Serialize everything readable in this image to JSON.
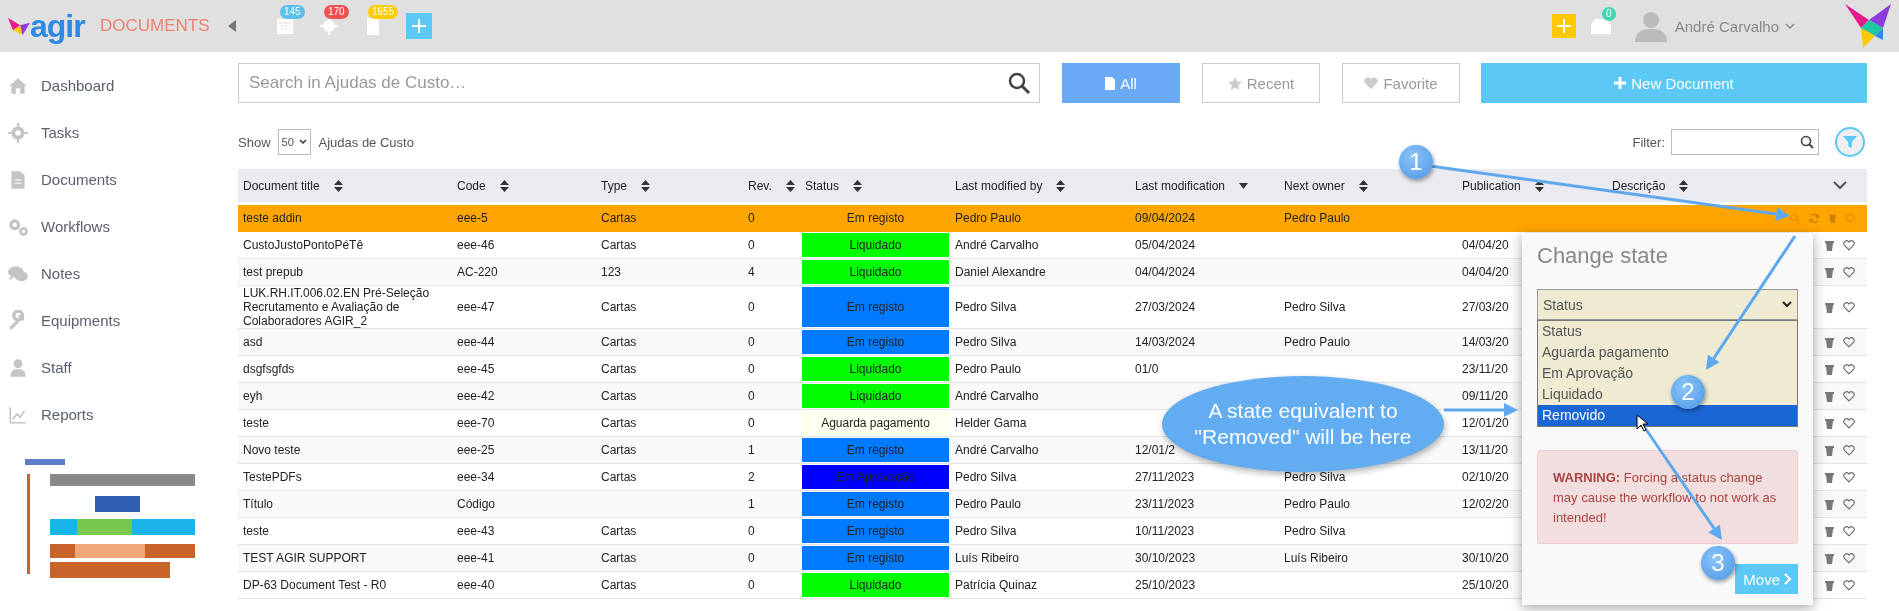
{
  "app": {
    "logo_text": "agir",
    "module": "DOCUMENTS"
  },
  "top_bar": {
    "badges": [
      {
        "count": "145",
        "color": "#5bc0eb"
      },
      {
        "count": "170",
        "color": "#f05050"
      },
      {
        "count": "1655",
        "color": "#ffcc00"
      }
    ],
    "inbox_count": "0",
    "user_name": "André Carvalho"
  },
  "sidebar": {
    "items": [
      {
        "label": "Dashboard"
      },
      {
        "label": "Tasks"
      },
      {
        "label": "Documents"
      },
      {
        "label": "Workflows"
      },
      {
        "label": "Notes"
      },
      {
        "label": "Equipments"
      },
      {
        "label": "Staff"
      },
      {
        "label": "Reports"
      }
    ]
  },
  "search": {
    "placeholder": "Search in Ajudas de Custo…"
  },
  "view_buttons": [
    {
      "label": "All",
      "selected": true
    },
    {
      "label": "Recent",
      "selected": false
    },
    {
      "label": "Favorite",
      "selected": false
    }
  ],
  "new_button": "New Document",
  "show": {
    "label": "Show",
    "value": "50",
    "suffix": "Ajudas de Custo"
  },
  "filter": {
    "label": "Filter:"
  },
  "table": {
    "columns": [
      {
        "label": "Document title",
        "sorted_desc": false
      },
      {
        "label": "Code",
        "sorted_desc": false
      },
      {
        "label": "Type",
        "sorted_desc": false
      },
      {
        "label": "Rev.",
        "sorted_desc": false
      },
      {
        "label": "Status",
        "sorted_desc": false
      },
      {
        "label": "Last modified by",
        "sorted_desc": false
      },
      {
        "label": "Last modification",
        "sorted_desc": true
      },
      {
        "label": "Next owner",
        "sorted_desc": false
      },
      {
        "label": "Publication",
        "sorted_desc": false
      },
      {
        "label": "Descrição",
        "sorted_desc": false
      }
    ],
    "rows": [
      {
        "title": "teste addin",
        "code": "eee-5",
        "type": "Cartas",
        "rev": "0",
        "status": {
          "label": "Em registo"
        },
        "modified_by": "Pedro Paulo",
        "last_modification": "09/04/2024",
        "next_owner": "Pedro Paulo",
        "selected": true
      },
      {
        "title": "CustoJustoPontoPéTê",
        "code": "eee-46",
        "type": "Cartas",
        "rev": "0",
        "status": {
          "label": "Liquidado",
          "color": "#00ff00"
        },
        "modified_by": "André Carvalho",
        "last_modification": "05/04/2024",
        "publication": "04/04/20",
        "selected": false
      },
      {
        "title": "test prepub",
        "code": "AC-220",
        "type": "123",
        "rev": "4",
        "status": {
          "label": "Liquidado",
          "color": "#00ff00"
        },
        "modified_by": "Daniel Alexandre",
        "last_modification": "04/04/2024",
        "publication": "04/04/20",
        "selected": false
      },
      {
        "title": "LUK.RH.IT.006.02.EN Pré-Seleção Recrutamento e Avaliação de Colaboradores AGIR_2",
        "code": "eee-47",
        "type": "Cartas",
        "rev": "0",
        "status": {
          "label": "Em registo",
          "color": "#007bff"
        },
        "modified_by": "Pedro Silva",
        "last_modification": "27/03/2024",
        "next_owner": "Pedro Silva",
        "publication": "27/03/20",
        "selected": false
      },
      {
        "title": "asd",
        "code": "eee-44",
        "type": "Cartas",
        "rev": "0",
        "status": {
          "label": "Em registo",
          "color": "#007bff"
        },
        "modified_by": "Pedro Silva",
        "last_modification": "14/03/2024",
        "next_owner": "Pedro Paulo",
        "publication": "14/03/20",
        "selected": false
      },
      {
        "title": "dsgfsgfds",
        "code": "eee-45",
        "type": "Cartas",
        "rev": "0",
        "status": {
          "label": "Liquidado",
          "color": "#00ff00"
        },
        "modified_by": "Pedro Paulo",
        "last_modification": "01/0",
        "publication": "23/11/20",
        "selected": false
      },
      {
        "title": "eyh",
        "code": "eee-42",
        "type": "Cartas",
        "rev": "0",
        "status": {
          "label": "Liquidado",
          "color": "#00ff00"
        },
        "modified_by": "André Carvalho",
        "publication": "09/11/20",
        "selected": false
      },
      {
        "title": "teste",
        "code": "eee-70",
        "type": "Cartas",
        "rev": "0",
        "status": {
          "label": "Aguarda pagamento",
          "color": "#fffff0"
        },
        "modified_by": "Helder Gama",
        "publication": "12/01/20",
        "selected": false
      },
      {
        "title": "Novo teste",
        "code": "eee-25",
        "type": "Cartas",
        "rev": "1",
        "status": {
          "label": "Em registo",
          "color": "#007bff"
        },
        "modified_by": "André Carvalho",
        "last_modification": "12/01/2",
        "publication": "13/11/20",
        "selected": false
      },
      {
        "title": "TestePDFs",
        "code": "eee-34",
        "type": "Cartas",
        "rev": "2",
        "status": {
          "label": "Em Aprovação",
          "color": "#0000ff"
        },
        "modified_by": "Pedro Silva",
        "last_modification": "27/11/2023",
        "next_owner": "Pedro Silva",
        "publication": "02/10/20",
        "selected": false
      },
      {
        "title": "Título",
        "code": "Código",
        "rev": "1",
        "status": {
          "label": "Em registo",
          "color": "#007bff"
        },
        "modified_by": "Pedro Paulo",
        "last_modification": "23/11/2023",
        "next_owner": "Pedro Paulo",
        "publication": "12/02/20",
        "selected": false
      },
      {
        "title": "teste",
        "code": "eee-43",
        "type": "Cartas",
        "rev": "0",
        "status": {
          "label": "Em registo",
          "color": "#007bff"
        },
        "modified_by": "Pedro Silva",
        "last_modification": "10/11/2023",
        "next_owner": "Pedro Silva",
        "selected": false
      },
      {
        "title": "TEST AGIR SUPPORT",
        "code": "eee-41",
        "type": "Cartas",
        "rev": "0",
        "status": {
          "label": "Em registo",
          "color": "#007bff"
        },
        "modified_by": "Luís Ribeiro",
        "last_modification": "30/10/2023",
        "next_owner": "Luís Ribeiro",
        "publication": "30/10/20",
        "selected": false
      },
      {
        "title": "DP-63 Document Test - R0",
        "code": "eee-40",
        "type": "Cartas",
        "rev": "0",
        "status": {
          "label": "Liquidado",
          "color": "#00ff00"
        },
        "modified_by": "Patrícia Quinaz",
        "last_modification": "25/10/2023",
        "publication": "25/10/20",
        "selected": false
      }
    ]
  },
  "change_state_popup": {
    "title": "Change state",
    "select_value": "Status",
    "options": [
      {
        "label": "Status",
        "selected": false
      },
      {
        "label": "Aguarda pagamento",
        "selected": false
      },
      {
        "label": "Em Aprovação",
        "selected": false
      },
      {
        "label": "Liquidado",
        "selected": false
      },
      {
        "label": "Removido",
        "selected": true
      }
    ],
    "warning": "**WARNING:** Forcing a status change may cause the workflow to not work as intended!",
    "button": "Move"
  },
  "annotations": {
    "steps": [
      "1",
      "2",
      "3"
    ],
    "callout": "A state equivalent to \"Removed\" will be here"
  }
}
